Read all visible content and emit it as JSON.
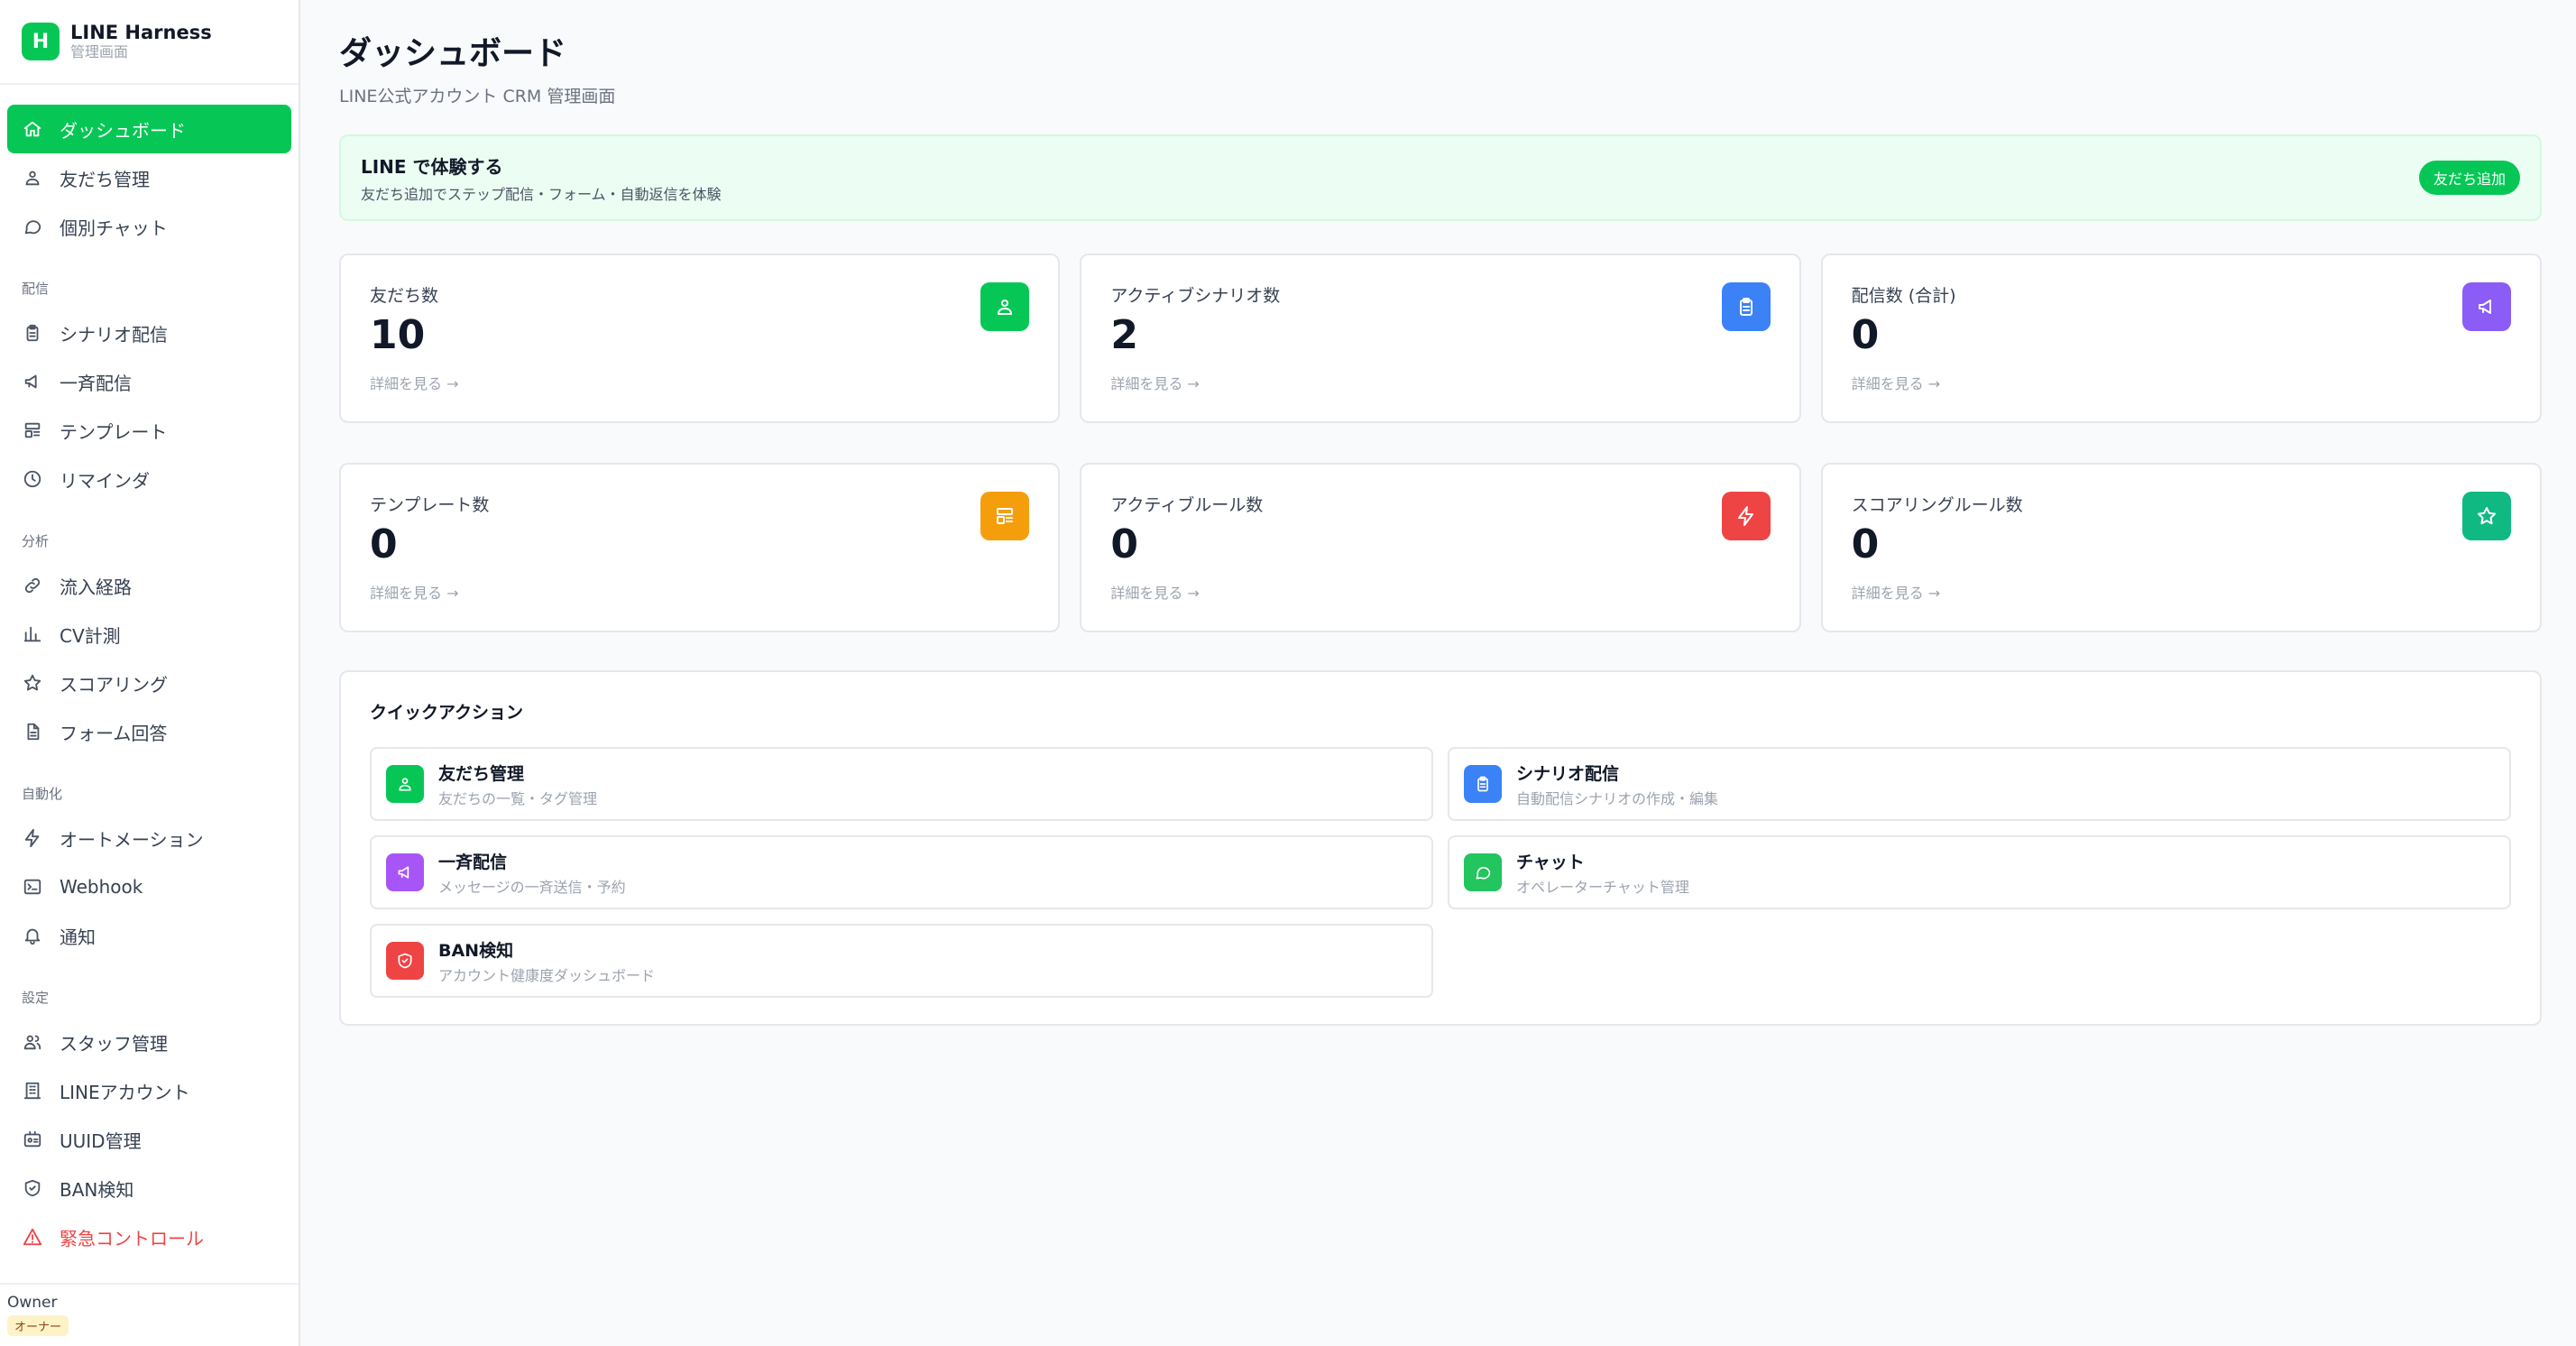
{
  "app": {
    "logo_letter": "H",
    "title": "LINE Harness",
    "subtitle": "管理画面"
  },
  "sidebar": {
    "top_items": [
      {
        "label": "ダッシュボード",
        "icon": "home-icon",
        "active": true
      },
      {
        "label": "友だち管理",
        "icon": "users-icon"
      },
      {
        "label": "個別チャット",
        "icon": "chat-icon"
      }
    ],
    "sections": [
      {
        "title": "配信",
        "items": [
          {
            "label": "シナリオ配信",
            "icon": "clipboard-icon"
          },
          {
            "label": "一斉配信",
            "icon": "megaphone-icon"
          },
          {
            "label": "テンプレート",
            "icon": "template-icon"
          },
          {
            "label": "リマインダ",
            "icon": "clock-icon"
          }
        ]
      },
      {
        "title": "分析",
        "items": [
          {
            "label": "流入経路",
            "icon": "link-icon"
          },
          {
            "label": "CV計測",
            "icon": "bar-chart-icon"
          },
          {
            "label": "スコアリング",
            "icon": "star-icon"
          },
          {
            "label": "フォーム回答",
            "icon": "document-icon"
          }
        ]
      },
      {
        "title": "自動化",
        "items": [
          {
            "label": "オートメーション",
            "icon": "bolt-icon"
          },
          {
            "label": "Webhook",
            "icon": "terminal-icon"
          },
          {
            "label": "通知",
            "icon": "bell-icon"
          }
        ]
      },
      {
        "title": "設定",
        "items": [
          {
            "label": "スタッフ管理",
            "icon": "staff-icon"
          },
          {
            "label": "LINEアカウント",
            "icon": "building-icon"
          },
          {
            "label": "UUID管理",
            "icon": "id-card-icon"
          },
          {
            "label": "BAN検知",
            "icon": "shield-icon"
          },
          {
            "label": "緊急コントロール",
            "icon": "warning-icon",
            "danger": true
          }
        ]
      }
    ],
    "owner": {
      "name": "Owner",
      "badge": "オーナー"
    }
  },
  "header": {
    "title": "ダッシュボード",
    "subtitle": "LINE公式アカウント CRM 管理画面"
  },
  "banner": {
    "title": "LINE で体験する",
    "subtitle": "友だち追加でステップ配信・フォーム・自動返信を体験",
    "button": "友だち追加"
  },
  "stats": [
    {
      "label": "友だち数",
      "value": "10",
      "link": "詳細を見る →",
      "icon": "users-icon",
      "color": "#06c755"
    },
    {
      "label": "アクティブシナリオ数",
      "value": "2",
      "link": "詳細を見る →",
      "icon": "clipboard-icon",
      "color": "#3b82f6"
    },
    {
      "label": "配信数 (合計)",
      "value": "0",
      "link": "詳細を見る →",
      "icon": "megaphone-icon",
      "color": "#8b5cf6"
    },
    {
      "label": "テンプレート数",
      "value": "0",
      "link": "詳細を見る →",
      "icon": "template-icon",
      "color": "#f59e0b"
    },
    {
      "label": "アクティブルール数",
      "value": "0",
      "link": "詳細を見る →",
      "icon": "bolt-icon",
      "color": "#ef4444"
    },
    {
      "label": "スコアリングルール数",
      "value": "0",
      "link": "詳細を見る →",
      "icon": "star-icon",
      "color": "#10b981"
    }
  ],
  "quick_actions": {
    "title": "クイックアクション",
    "items": [
      {
        "title": "友だち管理",
        "subtitle": "友だちの一覧・タグ管理",
        "icon": "users-icon",
        "color": "#06c755"
      },
      {
        "title": "シナリオ配信",
        "subtitle": "自動配信シナリオの作成・編集",
        "icon": "clipboard-icon",
        "color": "#3b82f6"
      },
      {
        "title": "一斉配信",
        "subtitle": "メッセージの一斉送信・予約",
        "icon": "megaphone-icon",
        "color": "#a855f7"
      },
      {
        "title": "チャット",
        "subtitle": "オペレーターチャット管理",
        "icon": "chat-icon",
        "color": "#22c55e"
      },
      {
        "title": "BAN検知",
        "subtitle": "アカウント健康度ダッシュボード",
        "icon": "shield-icon",
        "color": "#ef4444"
      }
    ]
  }
}
